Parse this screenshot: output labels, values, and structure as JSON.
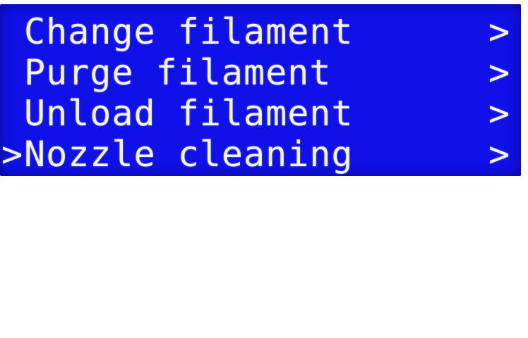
{
  "screen": {
    "background_color": "#1010e8",
    "text_color": "#f2f4ff",
    "selected_index": 3,
    "cursor_symbol": ">",
    "menu": [
      {
        "label": "Change filament",
        "submenu_indicator": ">"
      },
      {
        "label": "Purge filament",
        "submenu_indicator": ">"
      },
      {
        "label": "Unload filament",
        "submenu_indicator": ">"
      },
      {
        "label": "Nozzle cleaning",
        "submenu_indicator": ">"
      }
    ]
  }
}
